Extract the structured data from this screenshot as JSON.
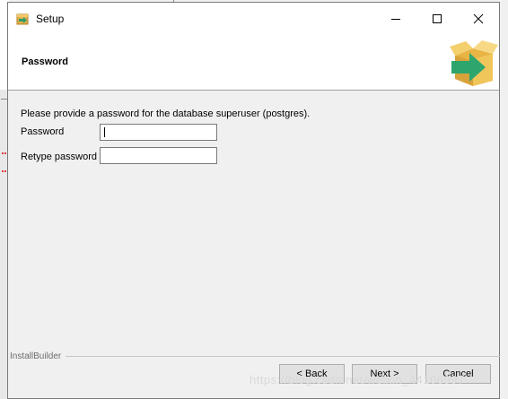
{
  "window": {
    "title": "Setup"
  },
  "header": {
    "title": "Password",
    "icon": "package-install-icon"
  },
  "content": {
    "description": "Please provide a password for the database superuser (postgres).",
    "password_label": "Password",
    "password_value": "",
    "retype_label": "Retype password",
    "retype_value": ""
  },
  "footer": {
    "brand": "InstallBuilder",
    "back_label": "< Back",
    "next_label": "Next >",
    "cancel_label": "Cancel"
  },
  "watermark": "https://blog.csdn.net/weixin_44106997"
}
